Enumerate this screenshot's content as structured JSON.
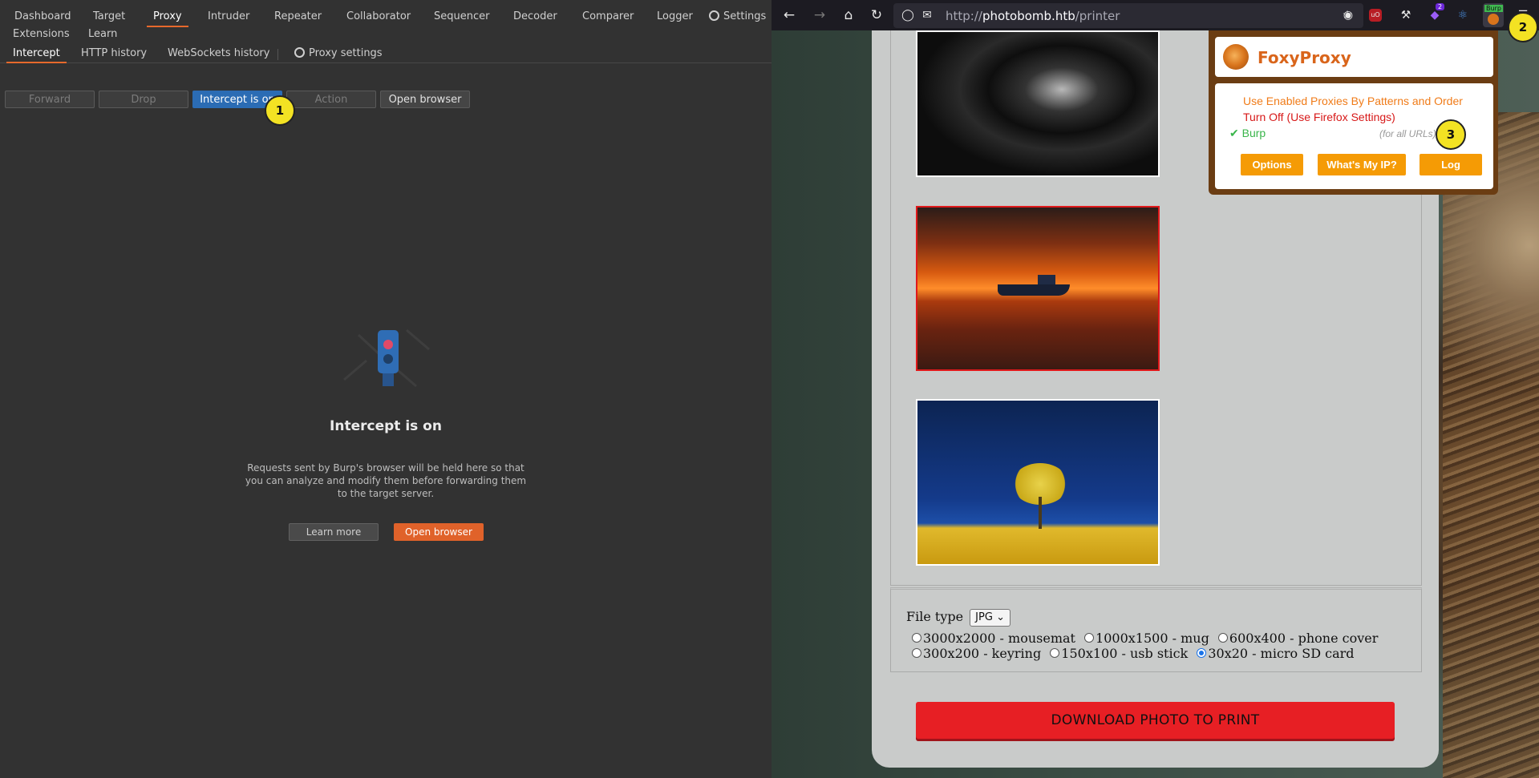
{
  "burp": {
    "main_tabs": [
      "Dashboard",
      "Target",
      "Proxy",
      "Intruder",
      "Repeater",
      "Collaborator",
      "Sequencer",
      "Decoder",
      "Comparer",
      "Logger",
      "Settings",
      "Extensions",
      "Learn"
    ],
    "sub_tabs": [
      "Intercept",
      "HTTP history",
      "WebSockets history",
      "Proxy settings"
    ],
    "buttons": {
      "forward": "Forward",
      "drop": "Drop",
      "intercept": "Intercept is on",
      "action": "Action",
      "open_browser": "Open browser"
    },
    "empty_state": {
      "title": "Intercept is on",
      "description": "Requests sent by Burp's browser will be held here so that you can analyze and modify them before forwarding them to the target server.",
      "learn_more": "Learn more",
      "open_browser": "Open browser"
    }
  },
  "annotations": [
    "1",
    "2",
    "3"
  ],
  "browser": {
    "url_prefix": "http://",
    "url_host": "photobomb.htb",
    "url_path": "/printer",
    "page": {
      "file_type_label": "File type",
      "file_type_value": "JPG",
      "sizes": [
        {
          "label": "3000x2000 - mousemat",
          "checked": false
        },
        {
          "label": "1000x1500 - mug",
          "checked": false
        },
        {
          "label": "600x400 - phone cover",
          "checked": false
        },
        {
          "label": "300x200 - keyring",
          "checked": false
        },
        {
          "label": "150x100 - usb stick",
          "checked": false
        },
        {
          "label": "30x20 - micro SD card",
          "checked": true
        }
      ],
      "download_label": "DOWNLOAD PHOTO TO PRINT"
    },
    "foxyproxy": {
      "title": "FoxyProxy",
      "option_patterns": "Use Enabled Proxies By Patterns and Order",
      "option_off": "Turn Off (Use Firefox Settings)",
      "option_burp": "✔ Burp",
      "burp_note": "(for all URLs)",
      "btn_options": "Options",
      "btn_whats_my_ip": "What's My IP?",
      "btn_log": "Log"
    },
    "extension_badge": "Burp",
    "notification_count": "2"
  }
}
